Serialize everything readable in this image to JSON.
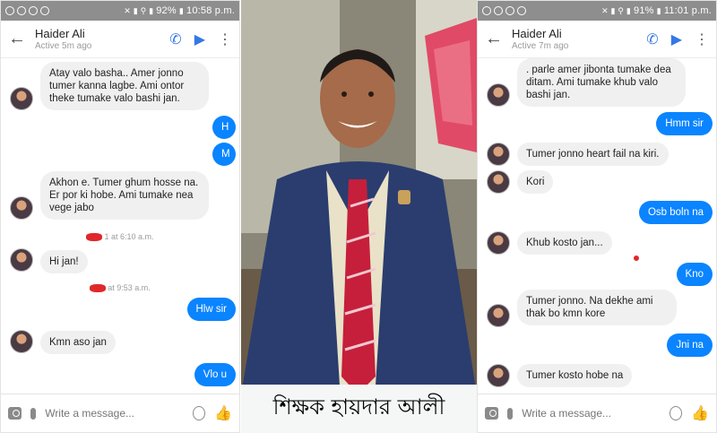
{
  "left_phone": {
    "status": {
      "battery": "92%",
      "time": "10:58 p.m."
    },
    "contact": {
      "name": "Haider Ali",
      "status": "Active 5m ago"
    },
    "messages": [
      {
        "text": "Atay valo basha.. Amer jonno tumer kanna lagbe. Ami ontor theke tumake valo bashi  jan."
      },
      {
        "text": "H"
      },
      {
        "text": "M"
      },
      {
        "text": "Akhon  e. Tumer  ghum  hosse na. Er por ki hobe. Ami tumake nea vege jabo"
      },
      {
        "text": "1  at 6:10 a.m."
      },
      {
        "text": "Hi jan!"
      },
      {
        "text": "at 9:53 a.m."
      },
      {
        "text": "Hlw sir"
      },
      {
        "text": "Kmn aso jan"
      },
      {
        "text": "Vlo u"
      }
    ],
    "composer_placeholder": "Write a message..."
  },
  "right_phone": {
    "status": {
      "battery": "91%",
      "time": "11:01 p.m."
    },
    "contact": {
      "name": "Haider Ali",
      "status": "Active 7m ago"
    },
    "messages": [
      {
        "text": ". parle amer jibonta tumake dea ditam. Ami  tumake  khub valo bashi jan."
      },
      {
        "text": "Hmm sir"
      },
      {
        "text": "Tumer jonno heart fail na kiri."
      },
      {
        "text": "Kori"
      },
      {
        "text": "Osb boln na"
      },
      {
        "text": "Khub kosto jan..."
      },
      {
        "text": "Kno"
      },
      {
        "text": "Tumer jonno. Na dekhe ami thak bo kmn kore"
      },
      {
        "text": "Jni na"
      },
      {
        "text": "Tumer  kosto hobe na"
      }
    ],
    "composer_placeholder": "Write a message..."
  },
  "photo": {
    "caption": "শিক্ষক হায়দার আলী"
  },
  "colors": {
    "outgoing_bubble": "#0a84ff",
    "incoming_bubble": "#f1f0f0",
    "status_bar": "#8e8e8e",
    "accent": "#3578e5"
  },
  "icons": [
    "back-arrow-icon",
    "phone-icon",
    "video-camera-icon",
    "more-vert-icon",
    "camera-icon",
    "mic-icon",
    "emoji-icon",
    "thumbs-up-icon"
  ]
}
